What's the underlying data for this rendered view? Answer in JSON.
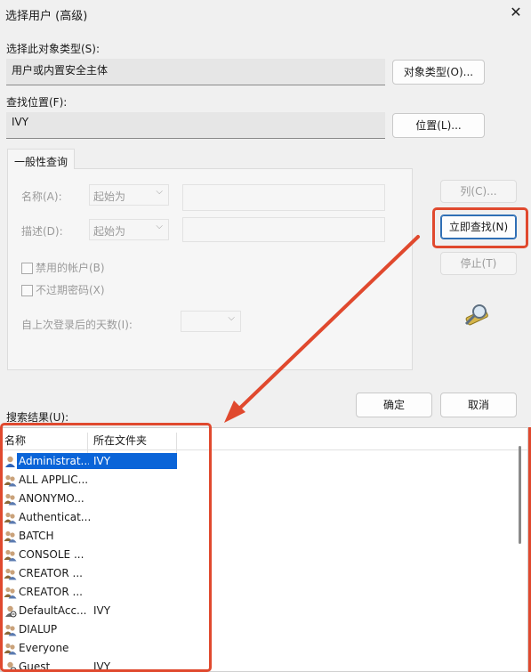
{
  "window": {
    "title": "选择用户 (高级)",
    "close_icon": "close-icon"
  },
  "object_type": {
    "label": "选择此对象类型(S):",
    "value": "用户或内置安全主体",
    "button": "对象类型(O)..."
  },
  "location": {
    "label": "查找位置(F):",
    "value": "IVY",
    "button": "位置(L)..."
  },
  "query": {
    "tab": "一般性查询",
    "name_label": "名称(A):",
    "name_mode": "起始为",
    "desc_label": "描述(D):",
    "desc_mode": "起始为",
    "disabled_accounts": "禁用的帐户(B)",
    "no_expire_pwd": "不过期密码(X)",
    "days_label": "自上次登录后的天数(I):"
  },
  "buttons": {
    "columns": "列(C)...",
    "find_now": "立即查找(N)",
    "stop": "停止(T)",
    "ok": "确定",
    "cancel": "取消"
  },
  "results": {
    "label": "搜索结果(U):",
    "columns": [
      "名称",
      "所在文件夹"
    ],
    "rows": [
      {
        "name": "Administrat...",
        "folder": "IVY",
        "selected": true,
        "icon": "user-icon"
      },
      {
        "name": "ALL APPLIC...",
        "folder": "",
        "icon": "group-icon"
      },
      {
        "name": "ANONYMO...",
        "folder": "",
        "icon": "group-icon"
      },
      {
        "name": "Authenticat...",
        "folder": "",
        "icon": "group-icon"
      },
      {
        "name": "BATCH",
        "folder": "",
        "icon": "group-icon"
      },
      {
        "name": "CONSOLE ...",
        "folder": "",
        "icon": "group-icon"
      },
      {
        "name": "CREATOR ...",
        "folder": "",
        "icon": "group-icon"
      },
      {
        "name": "CREATOR ...",
        "folder": "",
        "icon": "group-icon"
      },
      {
        "name": "DefaultAcc...",
        "folder": "IVY",
        "icon": "user-disabled-icon"
      },
      {
        "name": "DIALUP",
        "folder": "",
        "icon": "group-icon"
      },
      {
        "name": "Everyone",
        "folder": "",
        "icon": "group-icon"
      },
      {
        "name": "Guest",
        "folder": "IVY",
        "icon": "user-disabled-icon"
      }
    ]
  },
  "annotation": {
    "color": "#e0492e"
  }
}
